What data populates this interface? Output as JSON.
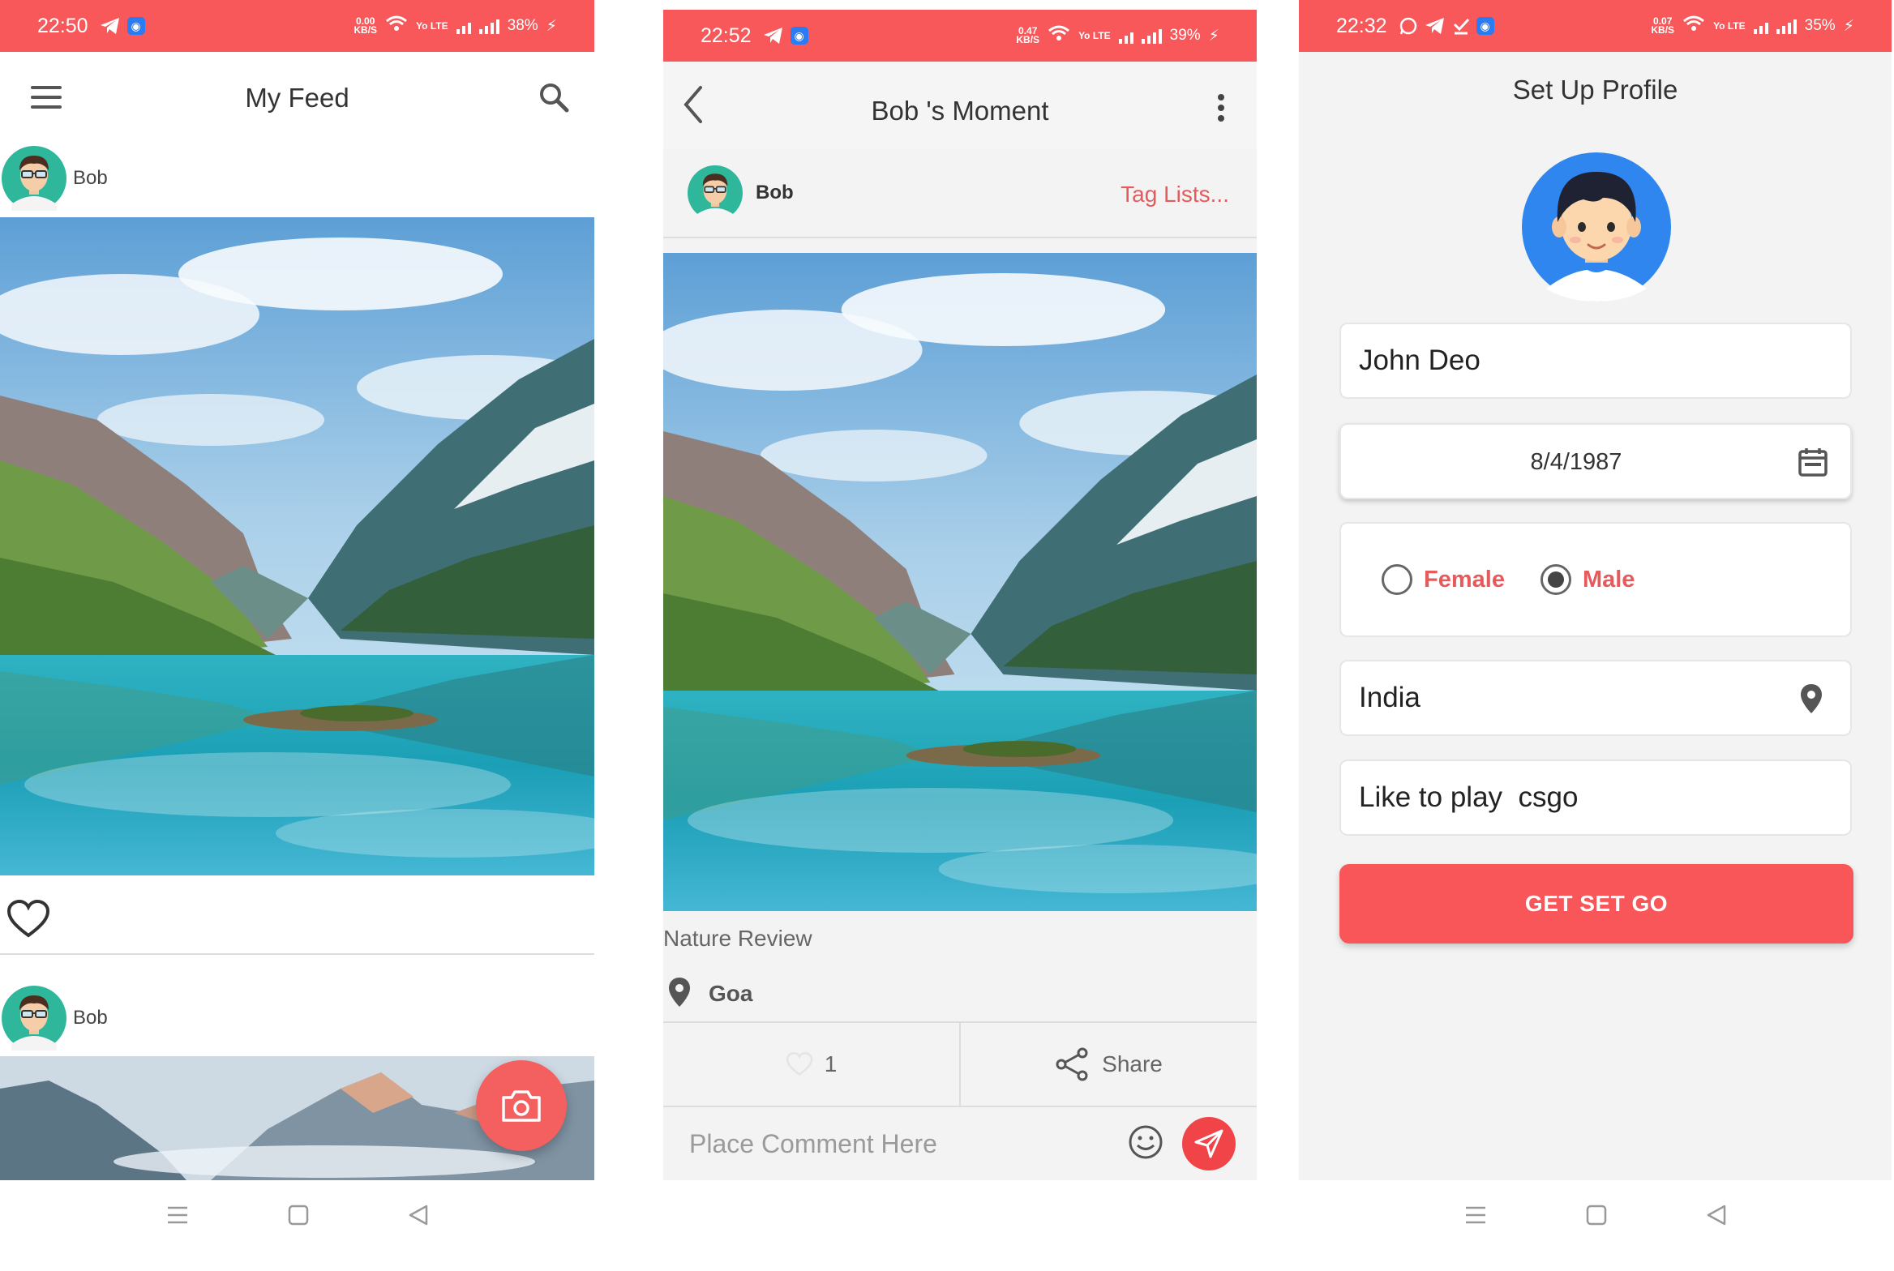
{
  "screens": {
    "feed": {
      "status": {
        "time": "22:50",
        "speed": "0.00",
        "speed_unit": "KB/S",
        "net": "Yo LTE",
        "battery": "38%"
      },
      "title": "My Feed",
      "posts": [
        {
          "author": "Bob"
        },
        {
          "author": "Bob"
        }
      ]
    },
    "moment": {
      "status": {
        "time": "22:52",
        "speed": "0.47",
        "speed_unit": "KB/S",
        "net": "Yo LTE",
        "battery": "39%"
      },
      "title": "Bob 's Moment",
      "author": "Bob",
      "tag_link": "Tag Lists...",
      "caption": "Nature Review",
      "location": "Goa",
      "like_count": "1",
      "share_label": "Share",
      "comment_placeholder": "Place Comment Here"
    },
    "profile": {
      "status": {
        "time": "22:32",
        "speed": "0.07",
        "speed_unit": "KB/S",
        "net": "Yo LTE",
        "battery": "35%"
      },
      "title": "Set Up Profile",
      "name": "John Deo",
      "dob": "8/4/1987",
      "gender_options": [
        "Female",
        "Male"
      ],
      "gender_selected": "Male",
      "country": "India",
      "bio": "Like to play  csgo",
      "submit_label": "GET SET GO"
    }
  },
  "colors": {
    "accent": "#f8585a",
    "link": "#e65a5c",
    "fab": "#f45f60"
  },
  "icons": [
    "menu-icon",
    "search-icon",
    "heart-icon",
    "camera-icon",
    "back-icon",
    "more-vert-icon",
    "location-pin-icon",
    "share-icon",
    "smile-icon",
    "send-icon",
    "calendar-icon"
  ]
}
